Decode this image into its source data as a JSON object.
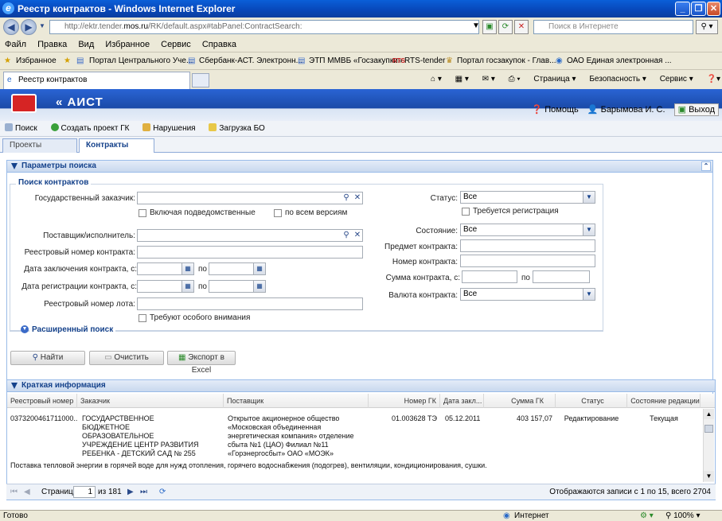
{
  "window": {
    "title": "Реестр контрактов - Windows Internet Explorer",
    "url_prefix": "http://ektr.tender.",
    "url_host": "mos.ru",
    "url_suffix": "/RK/default.aspx#tabPanel:ContractSearch:",
    "search_placeholder": "Поиск в Интернете"
  },
  "menu": [
    "Файл",
    "Правка",
    "Вид",
    "Избранное",
    "Сервис",
    "Справка"
  ],
  "favorites": {
    "label": "Избранное",
    "items": [
      "Портал Центрального Уче...",
      "Сбербанк-АСТ. Электронн...",
      "ЭТП ММВБ «Госзакупки»",
      "RTS-tender",
      "Портал госзакупок - Глав...",
      "ОАО Единая электронная ..."
    ]
  },
  "ie_tab": {
    "label": "Реестр контрактов"
  },
  "ie_tools": [
    "Страница ▾",
    "Безопасность ▾",
    "Сервис ▾"
  ],
  "app": {
    "name": "АИСТ",
    "help": "Помощь",
    "user": "Барымова И. С.",
    "exit": "Выход"
  },
  "toolbar": [
    "Поиск",
    "Создать проект  ГК",
    "Нарушения",
    "Загрузка БО"
  ],
  "app_tabs": [
    "Проекты контра...",
    "Контракты"
  ],
  "search_panel": {
    "title": "Параметры поиска",
    "legend": "Поиск контрактов",
    "labels": {
      "customer": "Государственный заказчик:",
      "include_sub": "Включая подведомственные",
      "all_versions": "по всем версиям",
      "supplier": "Поставщик/исполнитель:",
      "registry_number": "Реестровый номер контракта:",
      "conclusion_date": "Дата заключения контракта, с:",
      "registration_date": "Дата регистрации контракта, с:",
      "to": "по",
      "lot_number": "Реестровый номер лота:",
      "special_attention": "Требуют особого внимания",
      "status": "Статус:",
      "registration_required": "Требуется регистрация",
      "state": "Состояние:",
      "subject": "Предмет контракта:",
      "contract_number": "Номер контракта:",
      "contract_sum": "Сумма контракта, с:",
      "currency": "Валюта контракта:"
    },
    "values": {
      "status": "Все",
      "state": "Все",
      "currency": "Все"
    },
    "advanced": "Расширенный поиск",
    "buttons": {
      "find": "Найти",
      "clear": "Очистить",
      "export": "Экспорт в Excel"
    }
  },
  "results": {
    "title": "Краткая информация",
    "columns": [
      "Реестровый номер",
      "Заказчик",
      "Поставщик",
      "Номер ГК",
      "Дата закл...",
      "Сумма ГК",
      "Статус",
      "Состояние редакции"
    ],
    "row": {
      "registry": "0373200461711000...",
      "customer": "ГОСУДАРСТВЕННОЕ БЮДЖЕТНОЕ ОБРАЗОВАТЕЛЬНОЕ УЧРЕЖДЕНИЕ ЦЕНТР РАЗВИТИЯ РЕБЕНКА - ДЕТСКИЙ САД № 255",
      "supplier": "Открытое акционерное общество «Московская объединенная энергетическая компания» отделение сбыта №1 (ЦАО) Филиал №11 «Горэнергосбыт» ОАО «МОЭК»",
      "gk_number": "01.003628 ТЭ",
      "date": "05.12.2011",
      "sum": "403 157,07",
      "status": "Редактирование",
      "state": "Текущая",
      "subject": "Поставка тепловой энергии в горячей воде для нужд отопления, горячего водоснабжения (подогрев), вентиляции, кондиционирования, сушки."
    },
    "pager": {
      "page_label": "Страница",
      "page": "1",
      "of": "из 181",
      "summary": "Отображаются записи с 1 по 15, всего 2704"
    }
  },
  "status_bar": {
    "left": "Готово",
    "zone": "Интернет",
    "zoom": "100%"
  }
}
